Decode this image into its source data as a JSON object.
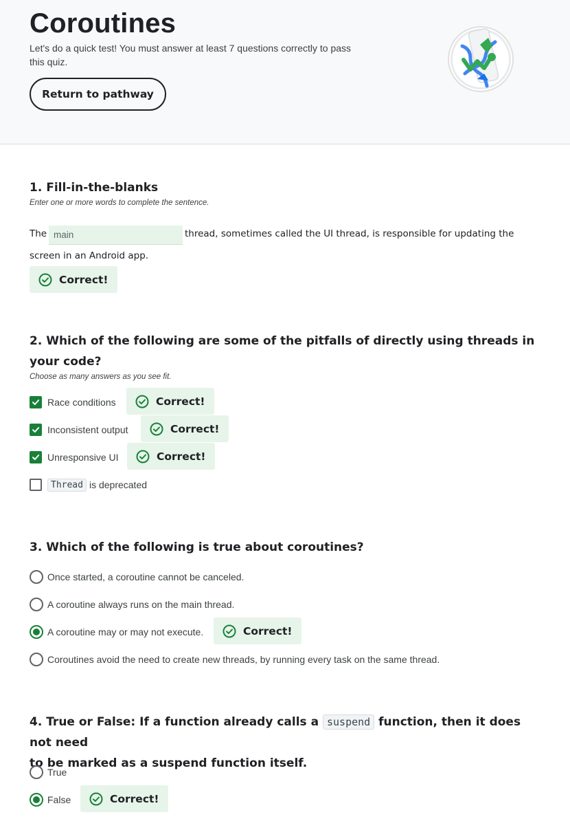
{
  "header": {
    "title": "Coroutines",
    "subtitle": "Let's do a quick test! You must answer at least 7 questions correctly to pass this quiz.",
    "return_button": "Return to pathway",
    "logo_icon": "android-coroutines-badge-icon"
  },
  "feedback": {
    "correct_label": "Correct!",
    "correct_icon": "check-circle-icon",
    "correct_bg": "#e6f4ea",
    "accent": "#188038"
  },
  "q1": {
    "title": "1. Fill-in-the-blanks",
    "hint": "Enter one or more words to complete the sentence.",
    "prefix": "The",
    "answer": "main",
    "suffix_line1": "thread, sometimes called the UI thread, is responsible for updating the",
    "suffix_line2": "screen in an Android app."
  },
  "q2": {
    "title": "2. Which of the following are some of the pitfalls of directly using threads in your code?",
    "hint": "Choose as many answers as you see fit.",
    "options": [
      {
        "label": "Race conditions",
        "checked": true
      },
      {
        "label": "Inconsistent output",
        "checked": true
      },
      {
        "label": "Unresponsive UI",
        "checked": true
      },
      {
        "code": "Thread",
        "label": "is deprecated",
        "checked": false
      }
    ]
  },
  "q3": {
    "title": "3. Which of the following is true about coroutines?",
    "options": [
      {
        "label": "Once started, a coroutine cannot be canceled.",
        "selected": false
      },
      {
        "label": "A coroutine always runs on the main thread.",
        "selected": false
      },
      {
        "label": "A coroutine may or may not execute.",
        "selected": true
      },
      {
        "label": "Coroutines avoid the need to create new threads, by running every task on the same thread.",
        "selected": false
      }
    ]
  },
  "q4": {
    "title_part1": "4. True or False: If a function already calls a",
    "title_code": "suspend",
    "title_part2": "function, then it does not need",
    "title_line2": "to be marked as a suspend function itself.",
    "options": [
      {
        "label": "True",
        "selected": false
      },
      {
        "label": "False",
        "selected": true
      }
    ]
  }
}
